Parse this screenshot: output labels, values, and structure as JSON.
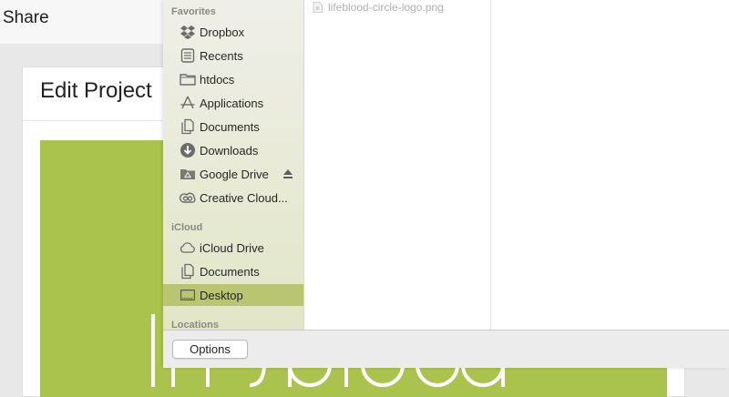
{
  "app": {
    "title": "Share",
    "card_title": "Edit Project",
    "banner_color": "#a9c34c"
  },
  "dialog": {
    "sections": [
      {
        "title": "Favorites",
        "items": [
          {
            "label": "Dropbox",
            "icon": "dropbox-icon"
          },
          {
            "label": "Recents",
            "icon": "recents-icon"
          },
          {
            "label": "htdocs",
            "icon": "folder-icon"
          },
          {
            "label": "Applications",
            "icon": "applications-icon"
          },
          {
            "label": "Documents",
            "icon": "documents-icon"
          },
          {
            "label": "Downloads",
            "icon": "downloads-icon"
          },
          {
            "label": "Google Drive",
            "icon": "google-drive-icon",
            "eject": true
          },
          {
            "label": "Creative Cloud...",
            "icon": "creative-cloud-icon"
          }
        ]
      },
      {
        "title": "iCloud",
        "items": [
          {
            "label": "iCloud Drive",
            "icon": "icloud-icon"
          },
          {
            "label": "Documents",
            "icon": "documents-icon"
          },
          {
            "label": "Desktop",
            "icon": "desktop-icon",
            "selected": true
          }
        ]
      },
      {
        "title": "Locations",
        "items": []
      }
    ],
    "file": {
      "name": "lifeblood-circle-logo.png",
      "icon": "image-file-icon"
    },
    "footer": {
      "options_label": "Options"
    }
  },
  "colors": {
    "sidebar_selected": "#b9c570",
    "banner": "#a9c34c"
  }
}
